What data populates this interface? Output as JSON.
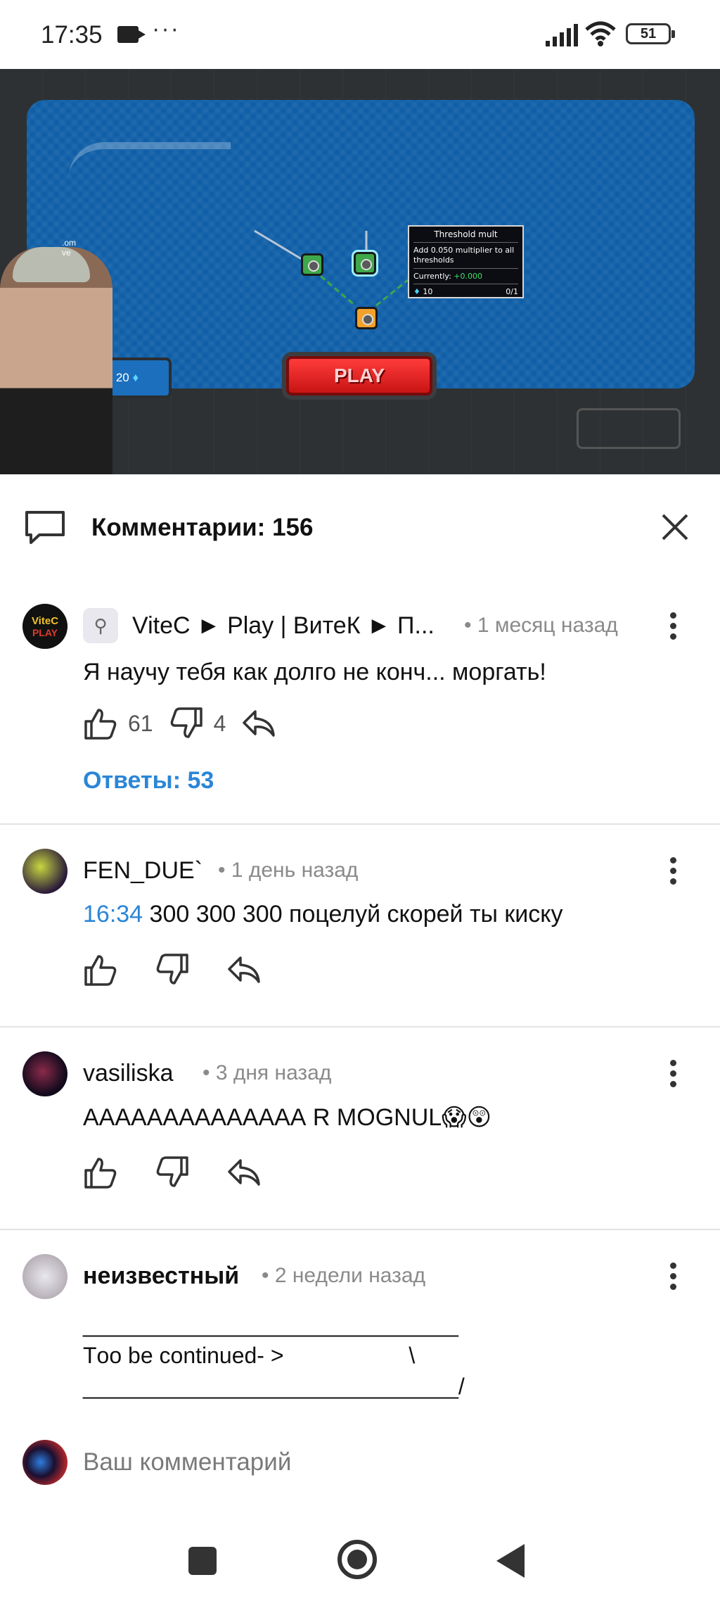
{
  "status_bar": {
    "time": "17:35",
    "overflow": "···",
    "battery": "51",
    "icons": [
      "video-camera-icon",
      "signal-icon",
      "wifi-icon",
      "battery-icon"
    ]
  },
  "video": {
    "tooltip": {
      "title": "Threshold mult",
      "description": "Add 0.050 multiplier to all thresholds",
      "current_label": "Currently:",
      "current_value": "+0.000",
      "cost": "10",
      "count": "0/1"
    },
    "resource_value": "20",
    "play_label": "PLAY",
    "cam_label_1": ".om",
    "cam_label_2": "ve"
  },
  "comments_header": {
    "title": "Комментарии: 156"
  },
  "comments": [
    {
      "author": "ViteC ► Play | ВитеК ► П...",
      "time": "• 1 месяц назад",
      "text": "Я научу тебя как долго не конч... моргать!",
      "likes": "61",
      "dislikes": "4",
      "replies": "Ответы: 53",
      "avatar_text_1": "ViteC",
      "avatar_text_2": "PLAY"
    },
    {
      "author": "FEN_DUE`",
      "time": "• 1 день назад",
      "timestamp_link": "16:34",
      "text": " 300 300 300 поцелуй скорей ты киску"
    },
    {
      "author": "vasiliska",
      "time": "• 3 дня назад",
      "text": "АААААААААААААА R MOGNUL😱😲"
    },
    {
      "author": "неизвестный",
      "time": "• 2 недели назад",
      "line1": "______________________________",
      "line2": "Тoo be continued- >                    \\",
      "line3": "______________________________/"
    }
  ],
  "compose": {
    "placeholder": "Ваш комментарий"
  },
  "colors": {
    "accent": "#2b86d6",
    "muted": "#8a8a8a",
    "divider": "#e3e3e3"
  }
}
